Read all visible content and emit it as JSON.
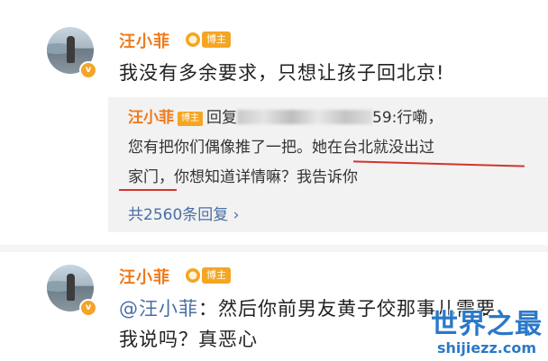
{
  "post1": {
    "username": "汪小菲",
    "tag": "博主",
    "vbadge": "v",
    "text": "我没有多余要求，只想让孩子回北京!",
    "reply": {
      "username": "汪小菲",
      "tag": "博主",
      "reply_word": "回复",
      "suffix": "59:行嘞，",
      "line2": "您有把你们偶像推了一把。她在台北就没出过",
      "line3": "家门，你想知道详情嘛？我告诉你",
      "more": "共2560条回复 ›"
    }
  },
  "post2": {
    "username": "汪小菲",
    "tag": "博主",
    "vbadge": "v",
    "mention": "@汪小菲",
    "text_rest": "：然后你前男友黄子佼那事儿需要",
    "text_line2": "我说吗？真恶心"
  },
  "watermark": {
    "title": "世界之最",
    "domain": "shijiezz.com"
  },
  "colors": {
    "username": "#f07a1a",
    "tag": "#f4a623",
    "link": "#4a6fa5",
    "underline": "#d3342b",
    "watermark": "#2a79c8"
  }
}
